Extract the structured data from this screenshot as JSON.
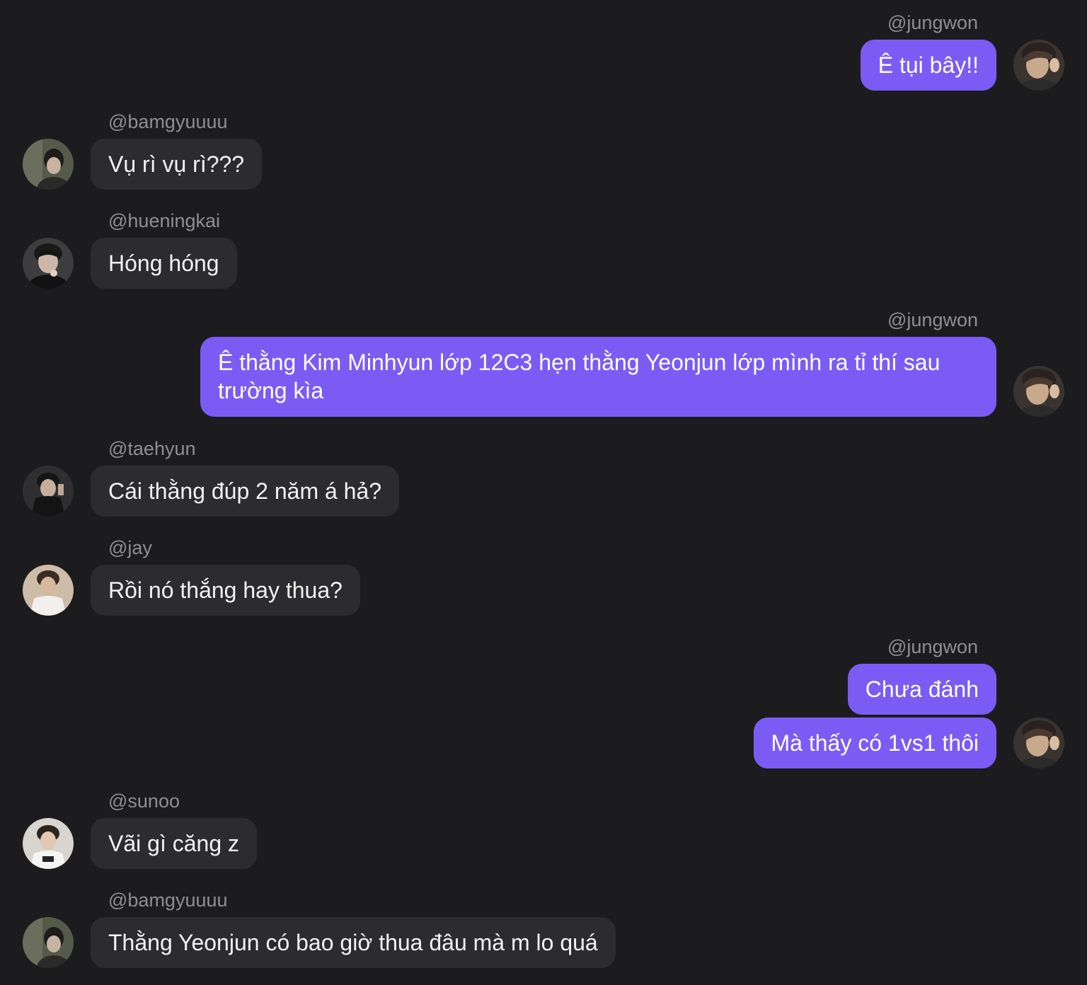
{
  "users": {
    "jungwon": "@jungwon",
    "bamgyuuuu": "@bamgyuuuu",
    "hueningkai": "@hueningkai",
    "taehyun": "@taehyun",
    "jay": "@jay",
    "sunoo": "@sunoo"
  },
  "messages": [
    {
      "user": "@jungwon",
      "text": "Ê tụi bây!!"
    },
    {
      "user": "@bamgyuuuu",
      "text": "Vụ rì vụ rì???"
    },
    {
      "user": "@hueningkai",
      "text": "Hóng hóng"
    },
    {
      "user": "@jungwon",
      "text": "Ê thằng Kim Minhyun lớp 12C3 hẹn thằng Yeonjun lớp mình ra tỉ thí sau trường kìa"
    },
    {
      "user": "@taehyun",
      "text": "Cái thằng đúp 2 năm á hả?"
    },
    {
      "user": "@jay",
      "text": "Rồi nó thắng hay thua?"
    },
    {
      "user": "@jungwon",
      "text": "Chưa đánh"
    },
    {
      "user": "@jungwon",
      "text": "Mà thấy có 1vs1 thôi"
    },
    {
      "user": "@sunoo",
      "text": "Vãi gì căng z"
    },
    {
      "user": "@bamgyuuuu",
      "text": "Thằng Yeonjun có bao giờ thua đâu mà m lo quá"
    }
  ],
  "colors": {
    "background": "#1c1c1e",
    "outgoing_bubble": "#7a5cf5",
    "incoming_bubble": "#2c2c2e",
    "username": "#8e8e93"
  },
  "avatar_icons": [
    "jungwon-avatar-icon",
    "bamgyuuuu-avatar-icon",
    "hueningkai-avatar-icon",
    "taehyun-avatar-icon",
    "jay-avatar-icon",
    "sunoo-avatar-icon"
  ]
}
